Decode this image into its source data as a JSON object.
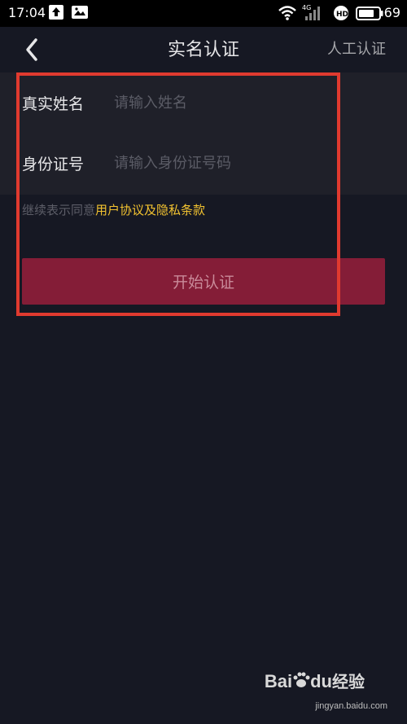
{
  "status_bar": {
    "time": "17:04",
    "battery_percent": "69",
    "network": "4G",
    "icons": [
      "upload-icon",
      "image-icon",
      "wifi-icon",
      "signal-icon",
      "hd-icon",
      "battery-icon"
    ]
  },
  "header": {
    "title": "实名认证",
    "right_link": "人工认证",
    "back_icon": "chevron-left-icon"
  },
  "form": {
    "name_label": "真实姓名",
    "name_placeholder": "请输入姓名",
    "name_value": "",
    "id_label": "身份证号",
    "id_placeholder": "请输入身份证号码",
    "id_value": ""
  },
  "agreement": {
    "prefix": "继续表示同意",
    "link": "用户协议及隐私条款"
  },
  "start_button": {
    "label": "开始认证"
  },
  "watermark": {
    "logo_text": "Bai",
    "logo_text2": "du",
    "logo_text3": "经验",
    "url": "jingyan.baidu.com"
  },
  "colors": {
    "background": "#161823",
    "card": "#1f2029",
    "button": "#841d37",
    "link": "#f2c230",
    "annotation": "#e03a2f"
  }
}
